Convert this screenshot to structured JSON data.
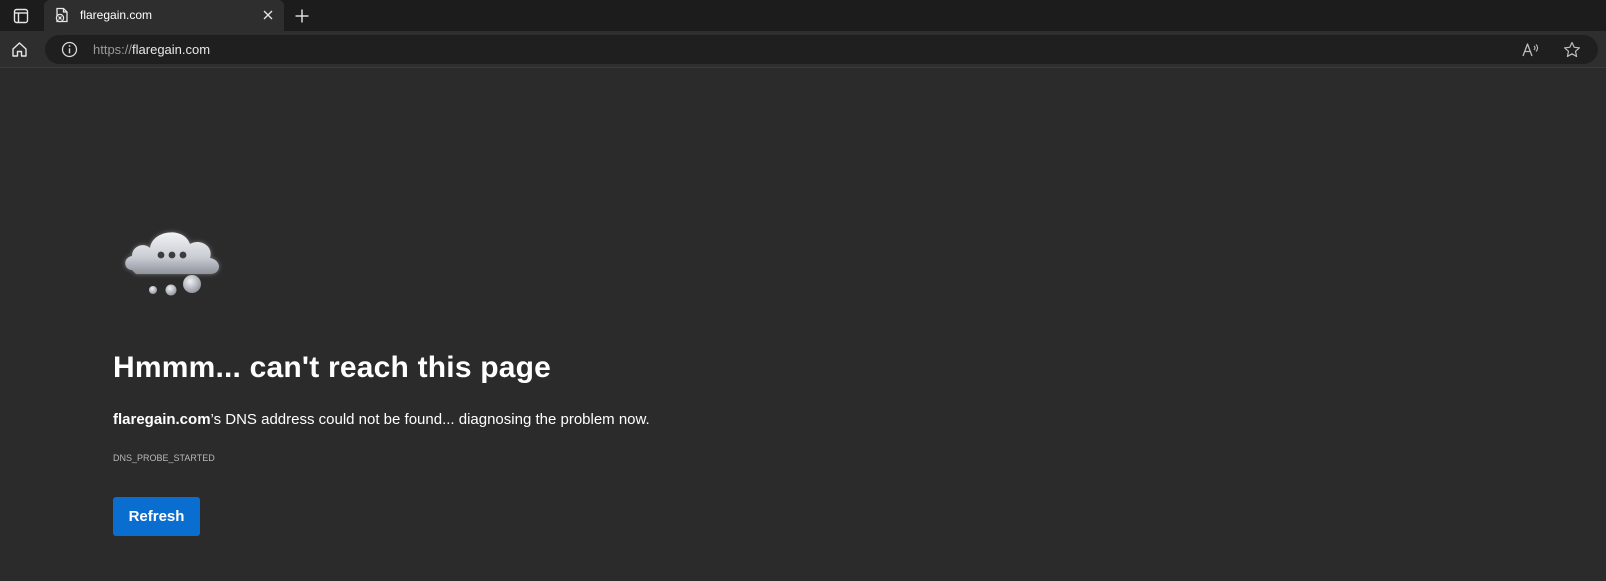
{
  "tabstrip": {
    "active_tab_title": "flaregain.com",
    "icons": {
      "tab_actions": "tab-actions-icon",
      "favicon": "error-page-favicon",
      "close": "close-icon",
      "new_tab": "plus-icon"
    }
  },
  "toolbar": {
    "url_scheme": "https://",
    "url_host": "flaregain.com",
    "icons": {
      "home": "home-icon",
      "site_info": "info-icon",
      "read_aloud": "read-aloud-icon",
      "favorite": "star-icon"
    }
  },
  "error_page": {
    "heading": "Hmmm... can't reach this page",
    "host": "flaregain.com",
    "message_rest": "’s DNS address could not be found... diagnosing the problem now.",
    "error_code": "DNS_PROBE_STARTED",
    "refresh_label": "Refresh",
    "illustration": "thinking-cloud-icon"
  },
  "colors": {
    "page_background": "#2b2b2b",
    "tabstrip_background": "#1c1c1c",
    "toolbar_background": "#2e2e2e",
    "address_bar_background": "#1f1f1f",
    "button_accent": "#0a6ed1",
    "text_primary": "#ffffff",
    "text_muted": "#9a9a9a"
  }
}
